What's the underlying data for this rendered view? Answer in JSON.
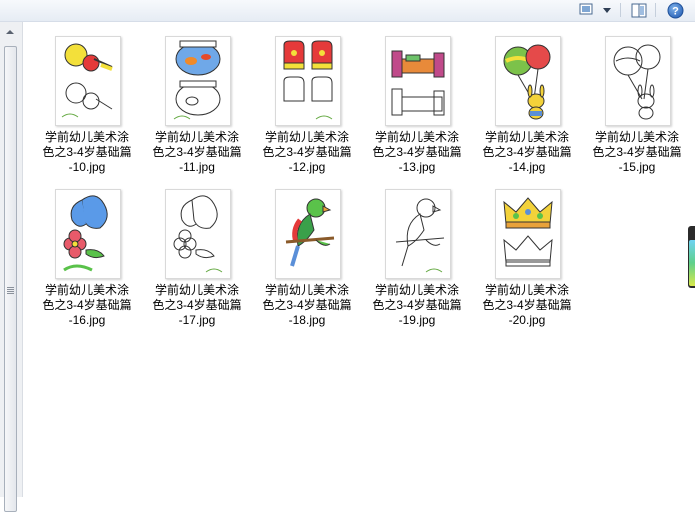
{
  "toolbar": {
    "views_icon": "views-icon",
    "dropdown_icon": "chevron-down-icon",
    "preview_icon": "preview-pane-icon",
    "help_icon": "help-icon",
    "help_glyph": "?"
  },
  "files": [
    {
      "name_line1": "学前幼儿美术涂",
      "name_line2": "色之3-4岁基础篇",
      "name_line3": "-10.jpg",
      "thumb": "rattle-colored"
    },
    {
      "name_line1": "学前幼儿美术涂",
      "name_line2": "色之3-4岁基础篇",
      "name_line3": "-11.jpg",
      "thumb": "fishbowl"
    },
    {
      "name_line1": "学前幼儿美术涂",
      "name_line2": "色之3-4岁基础篇",
      "name_line3": "-12.jpg",
      "thumb": "mittens"
    },
    {
      "name_line1": "学前幼儿美术涂",
      "name_line2": "色之3-4岁基础篇",
      "name_line3": "-13.jpg",
      "thumb": "bed"
    },
    {
      "name_line1": "学前幼儿美术涂",
      "name_line2": "色之3-4岁基础篇",
      "name_line3": "-14.jpg",
      "thumb": "balloons-colored"
    },
    {
      "name_line1": "学前幼儿美术涂",
      "name_line2": "色之3-4岁基础篇",
      "name_line3": "-15.jpg",
      "thumb": "balloons-outline"
    },
    {
      "name_line1": "学前幼儿美术涂",
      "name_line2": "色之3-4岁基础篇",
      "name_line3": "-16.jpg",
      "thumb": "flower-colored"
    },
    {
      "name_line1": "学前幼儿美术涂",
      "name_line2": "色之3-4岁基础篇",
      "name_line3": "-17.jpg",
      "thumb": "flower-outline"
    },
    {
      "name_line1": "学前幼儿美术涂",
      "name_line2": "色之3-4岁基础篇",
      "name_line3": "-18.jpg",
      "thumb": "parrot-colored"
    },
    {
      "name_line1": "学前幼儿美术涂",
      "name_line2": "色之3-4岁基础篇",
      "name_line3": "-19.jpg",
      "thumb": "parrot-outline"
    },
    {
      "name_line1": "学前幼儿美术涂",
      "name_line2": "色之3-4岁基础篇",
      "name_line3": "-20.jpg",
      "thumb": "crowns"
    }
  ]
}
